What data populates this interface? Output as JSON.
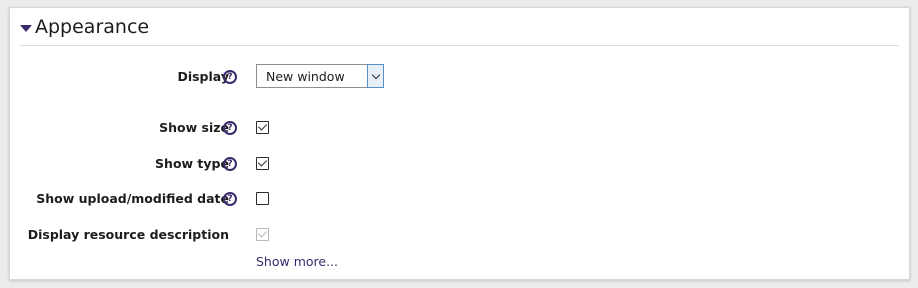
{
  "section": {
    "title": "Appearance",
    "expanded": true
  },
  "fields": {
    "display": {
      "label": "Display",
      "help_icon": "question-circle-icon",
      "value": "New window"
    },
    "show_size": {
      "label": "Show size",
      "help_icon": "question-circle-icon",
      "checked": true
    },
    "show_type": {
      "label": "Show type",
      "help_icon": "question-circle-icon",
      "checked": true
    },
    "show_date": {
      "label": "Show upload/modified date",
      "help_icon": "question-circle-icon",
      "checked": false
    },
    "display_description": {
      "label": "Display resource description",
      "checked": true,
      "disabled": true
    }
  },
  "show_more": "Show more...",
  "colors": {
    "accent": "#3b2a6b",
    "panel_bg": "#ffffff",
    "page_bg": "#ececec"
  },
  "help_glyph": "?"
}
